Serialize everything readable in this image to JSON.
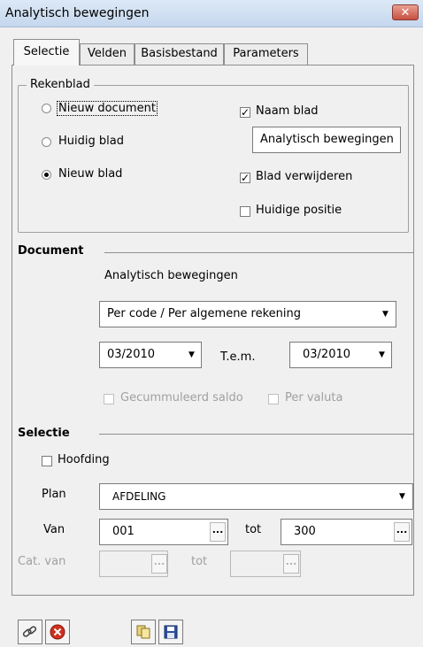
{
  "window": {
    "title": "Analytisch bewegingen",
    "close_label": "✕"
  },
  "tabs": [
    {
      "label": "Selectie"
    },
    {
      "label": "Velden"
    },
    {
      "label": "Basisbestand"
    },
    {
      "label": "Parameters"
    }
  ],
  "rekenblad": {
    "label": "Rekenblad",
    "radios": [
      {
        "label": "Nieuw document",
        "selected": false
      },
      {
        "label": "Huidig blad",
        "selected": false
      },
      {
        "label": "Nieuw blad",
        "selected": true
      }
    ],
    "naam_blad": {
      "label": "Naam blad",
      "checked": true,
      "value": "Analytisch bewegingen"
    },
    "blad_verwijderen": {
      "label": "Blad verwijderen",
      "checked": true
    },
    "huidige_positie": {
      "label": "Huidige positie",
      "checked": false
    }
  },
  "document": {
    "title": "Document",
    "name": "Analytisch bewegingen",
    "sort": "Per code / Per algemene rekening",
    "from_period": "03/2010",
    "to_label": "T.e.m.",
    "to_period": "03/2010",
    "gecummuleerd": {
      "label": "Gecummuleerd saldo",
      "checked": false,
      "enabled": false
    },
    "per_valuta": {
      "label": "Per valuta",
      "checked": false,
      "enabled": false
    }
  },
  "selectie": {
    "title": "Selectie",
    "hoofding": {
      "label": "Hoofding",
      "checked": false
    },
    "plan_label": "Plan",
    "plan_value": "AFDELING",
    "van_label": "Van",
    "van_value": "001",
    "tot_label": "tot",
    "tot_value": "300",
    "cat_van_label": "Cat. van",
    "cat_tot_label": "tot",
    "ellipsis": "..."
  },
  "toolbar": {
    "buttons": [
      {
        "icon": "link-icon"
      },
      {
        "icon": "cancel-icon"
      },
      {
        "icon": "copy-icon"
      },
      {
        "icon": "save-icon"
      }
    ]
  },
  "colors": {
    "cancel_red": "#d0301f",
    "title_bar": "#c5d7ee"
  }
}
